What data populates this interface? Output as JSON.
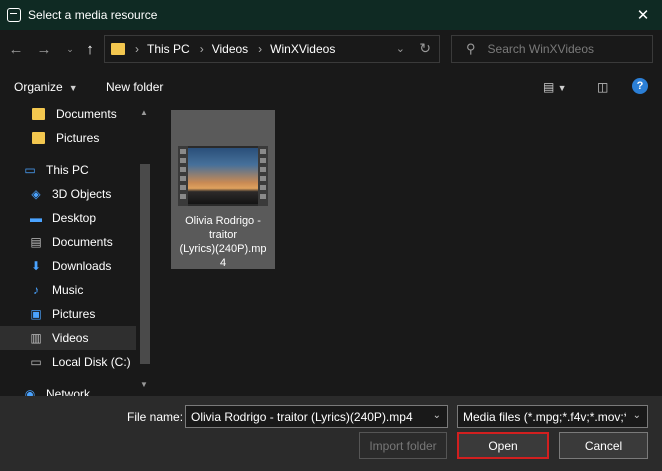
{
  "window": {
    "title": "Select a media resource",
    "close_icon": "close-icon"
  },
  "address": {
    "breadcrumbs": [
      "This PC",
      "Videos",
      "WinXVideos"
    ],
    "search_placeholder": "Search WinXVideos"
  },
  "toolbar": {
    "organize_label": "Organize",
    "new_folder_label": "New folder"
  },
  "nav": {
    "items": [
      {
        "label": "Documents",
        "icon": "folder-icon"
      },
      {
        "label": "Pictures",
        "icon": "folder-icon"
      },
      {
        "label": "This PC",
        "icon": "computer-icon"
      },
      {
        "label": "3D Objects",
        "icon": "cube-icon"
      },
      {
        "label": "Desktop",
        "icon": "desktop-icon"
      },
      {
        "label": "Documents",
        "icon": "document-icon"
      },
      {
        "label": "Downloads",
        "icon": "download-icon"
      },
      {
        "label": "Music",
        "icon": "music-icon"
      },
      {
        "label": "Pictures",
        "icon": "picture-icon"
      },
      {
        "label": "Videos",
        "icon": "video-icon"
      },
      {
        "label": "Local Disk (C:)",
        "icon": "disk-icon"
      },
      {
        "label": "Network",
        "icon": "network-icon"
      }
    ]
  },
  "files": [
    {
      "name": "Olivia Rodrigo - traitor (Lyrics)(240P).mp4",
      "label_lines": [
        "Olivia Rodrigo -",
        "traitor",
        "(Lyrics)(240P).mp",
        "4"
      ]
    }
  ],
  "footer": {
    "file_name_label": "File name:",
    "file_name_value": "Olivia Rodrigo - traitor (Lyrics)(240P).mp4",
    "file_type_value": "Media files (*.mpg;*.f4v;*.mov;*",
    "import_folder_label": "Import folder",
    "open_label": "Open",
    "cancel_label": "Cancel"
  },
  "colors": {
    "titlebar": "#0f2a23",
    "accent_highlight": "#d21f1f",
    "folder": "#f3c74f"
  }
}
